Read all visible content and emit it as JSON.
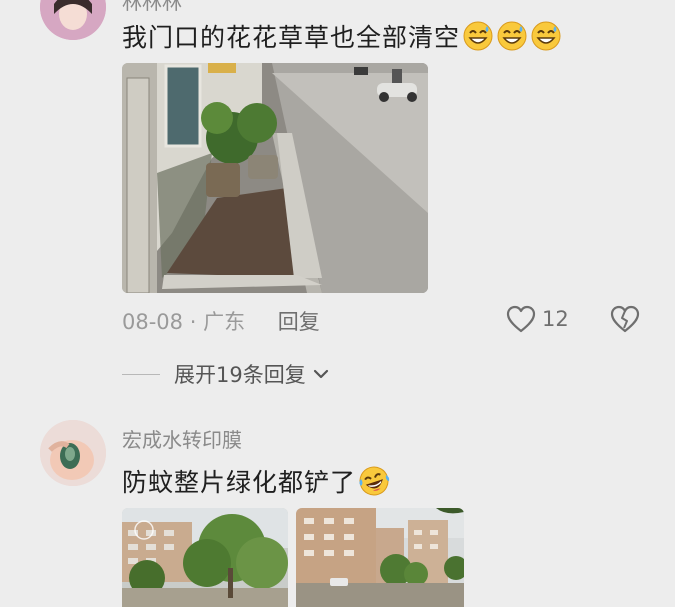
{
  "comment1": {
    "author": "林林林",
    "text": "我门口的花花草草也全部清空",
    "emojis": [
      "laugh-sweat-emoji",
      "laugh-sweat-emoji",
      "laugh-sweat-emoji"
    ],
    "date": "08-08",
    "separator": "·",
    "location": "广东",
    "reply_label": "回复",
    "like_count": "12",
    "expand_label": "展开19条回复"
  },
  "comment2": {
    "author": "宏成水转印膜",
    "text": "防蚊整片绿化都铲了",
    "emojis": [
      "laugh-cry-emoji"
    ]
  },
  "colors": {
    "background": "#ededed",
    "text_primary": "#1f1f1f",
    "text_secondary": "#9a9a9a",
    "icon": "#6f6f6f"
  }
}
